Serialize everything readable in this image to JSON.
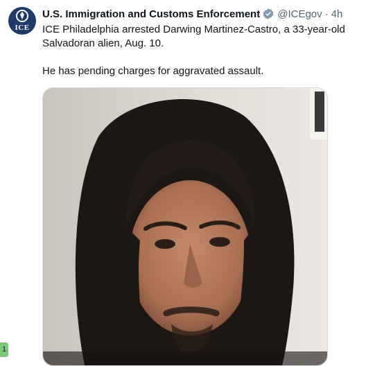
{
  "tweet": {
    "author": {
      "display_name": "U.S. Immigration and Customs Enforcement",
      "handle": "@ICEgov",
      "verified": true,
      "avatar_text": "ICE",
      "avatar_color": "#1f3a68",
      "verified_color": "#829aab"
    },
    "separator": "·",
    "time": "4h",
    "text_lines": [
      "ICE Philadelphia arrested Darwing Martinez-Castro, a 33-year-old Salvadoran alien, Aug. 10.",
      "He has pending charges for aggravated assault."
    ],
    "media": {
      "kind": "photo",
      "subject": "booking-photo"
    }
  },
  "side_badge": {
    "text": "1",
    "color": "#7fc97f"
  }
}
